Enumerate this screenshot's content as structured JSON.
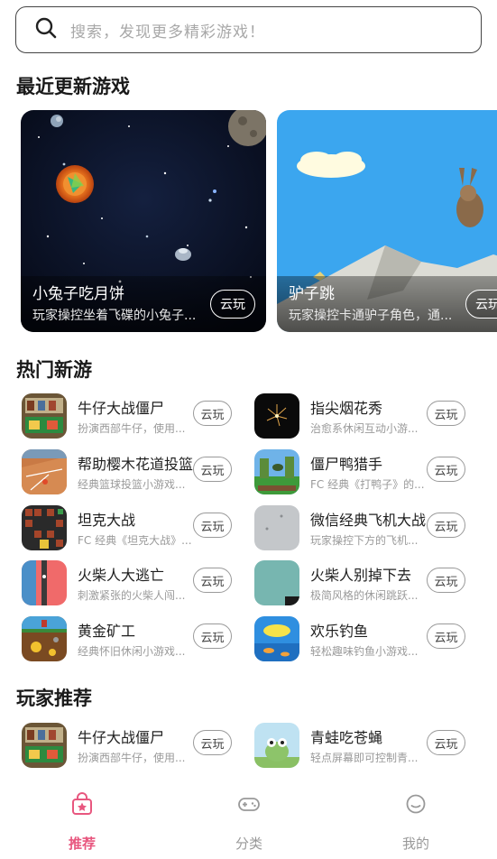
{
  "search": {
    "placeholder": "搜索，发现更多精彩游戏！",
    "icon": "search-icon"
  },
  "sections": {
    "recent": "最近更新游戏",
    "hot": "热门新游",
    "recommend": "玩家推荐"
  },
  "play_label": "云玩",
  "banners": [
    {
      "title": "小兔子吃月饼",
      "desc": "玩家操控坐着飞碟的小兔子..."
    },
    {
      "title": "驴子跳",
      "desc": "玩家操控卡通驴子角色，通..."
    }
  ],
  "hot_games": [
    {
      "name": "牛仔大战僵尸",
      "desc": "扮演西部牛仔，使用..."
    },
    {
      "name": "指尖烟花秀",
      "desc": "治愈系休闲互动小游..."
    },
    {
      "name": "帮助樱木花道投篮",
      "desc": "经典篮球投篮小游戏..."
    },
    {
      "name": "僵尸鸭猎手",
      "desc": "FC 经典《打鸭子》的..."
    },
    {
      "name": "坦克大战",
      "desc": "FC 经典《坦克大战》..."
    },
    {
      "name": "微信经典飞机大战",
      "desc": "玩家操控下方的飞机..."
    },
    {
      "name": "火柴人大逃亡",
      "desc": "刺激紧张的火柴人闯..."
    },
    {
      "name": "火柴人别掉下去",
      "desc": "极简风格的休闲跳跃..."
    },
    {
      "name": "黄金矿工",
      "desc": "经典怀旧休闲小游戏..."
    },
    {
      "name": "欢乐钓鱼",
      "desc": "轻松趣味钓鱼小游戏..."
    }
  ],
  "recommend_games": [
    {
      "name": "牛仔大战僵尸",
      "desc": "扮演西部牛仔，使用..."
    },
    {
      "name": "青蛙吃苍蝇",
      "desc": "轻点屏幕即可控制青..."
    }
  ],
  "tabs": [
    {
      "label": "推荐",
      "icon": "star-bag-icon",
      "active": true
    },
    {
      "label": "分类",
      "icon": "gamepad-icon",
      "active": false
    },
    {
      "label": "我的",
      "icon": "smiley-icon",
      "active": false
    }
  ],
  "colors": {
    "accent": "#e8577f"
  }
}
